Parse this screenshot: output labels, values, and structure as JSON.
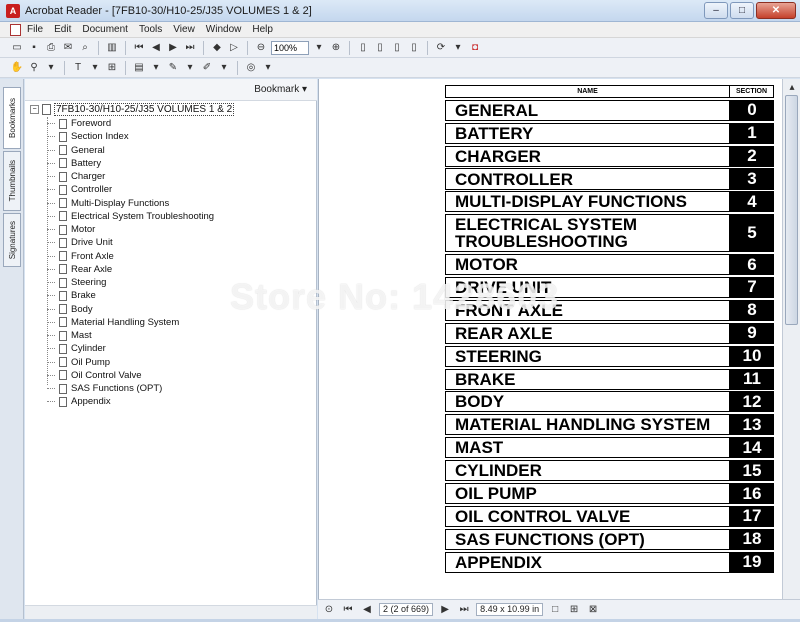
{
  "window": {
    "title": "Acrobat Reader - [7FB10-30/H10-25/J35 VOLUMES 1 & 2]",
    "minimize": "–",
    "maximize": "□",
    "close": "✕"
  },
  "menu": [
    "File",
    "Edit",
    "Document",
    "Tools",
    "View",
    "Window",
    "Help"
  ],
  "toolbar": {
    "zoom": "100%"
  },
  "nav_tabs": [
    "Bookmarks",
    "Thumbnails",
    "Signatures"
  ],
  "bookmarks": {
    "header_label": "Bookmark ▾",
    "root": "7FB10-30/H10-25/J35 VOLUMES 1 & 2",
    "items": [
      "Foreword",
      "Section Index",
      "General",
      "Battery",
      "Charger",
      "Controller",
      "Multi-Display Functions",
      "Electrical System Troubleshooting",
      "Motor",
      "Drive Unit",
      "Front Axle",
      "Rear Axle",
      "Steering",
      "Brake",
      "Body",
      "Material Handling System",
      "Mast",
      "Cylinder",
      "Oil Pump",
      "Oil Control Valve",
      "SAS Functions (OPT)",
      "Appendix"
    ]
  },
  "toc": {
    "head_name": "NAME",
    "head_section": "SECTION",
    "rows": [
      {
        "name": "GENERAL",
        "section": "0"
      },
      {
        "name": "BATTERY",
        "section": "1"
      },
      {
        "name": "CHARGER",
        "section": "2"
      },
      {
        "name": "CONTROLLER",
        "section": "3"
      },
      {
        "name": "MULTI-DISPLAY FUNCTIONS",
        "section": "4"
      },
      {
        "name": "ELECTRICAL SYSTEM\nTROUBLESHOOTING",
        "section": "5",
        "tall": true
      },
      {
        "name": "MOTOR",
        "section": "6"
      },
      {
        "name": "DRIVE UNIT",
        "section": "7"
      },
      {
        "name": "FRONT AXLE",
        "section": "8"
      },
      {
        "name": "REAR AXLE",
        "section": "9"
      },
      {
        "name": "STEERING",
        "section": "10"
      },
      {
        "name": "BRAKE",
        "section": "11"
      },
      {
        "name": "BODY",
        "section": "12"
      },
      {
        "name": "MATERIAL HANDLING SYSTEM",
        "section": "13"
      },
      {
        "name": "MAST",
        "section": "14"
      },
      {
        "name": "CYLINDER",
        "section": "15"
      },
      {
        "name": "OIL PUMP",
        "section": "16"
      },
      {
        "name": "OIL CONTROL VALVE",
        "section": "17"
      },
      {
        "name": "SAS FUNCTIONS (OPT)",
        "section": "18"
      },
      {
        "name": "APPENDIX",
        "section": "19"
      }
    ]
  },
  "status": {
    "page": "2",
    "page_of": "(2 of 669)",
    "page_size": "8.49 x 10.99 in"
  },
  "watermark": "Store No: 1428603"
}
